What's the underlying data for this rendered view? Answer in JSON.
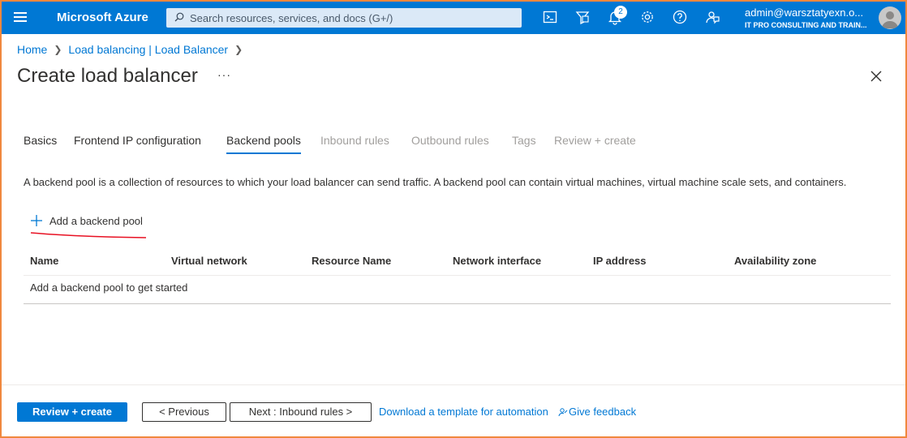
{
  "topbar": {
    "brand": "Microsoft Azure",
    "search_placeholder": "Search resources, services, and docs (G+/)",
    "notification_count": "2",
    "account_email": "admin@warsztatyexn.o...",
    "account_org": "IT PRO CONSULTING AND TRAIN...",
    "icons": [
      "menu-icon",
      "cloud-shell-icon",
      "directory-filter-icon",
      "bell-icon",
      "gear-icon",
      "help-icon",
      "feedback-icon"
    ],
    "accent": "#0078d4"
  },
  "breadcrumb": [
    "Home",
    "Load balancing | Load Balancer"
  ],
  "page": {
    "title": "Create load balancer",
    "more": "···"
  },
  "tabs": [
    {
      "label": "Basics",
      "state": "normal"
    },
    {
      "label": "Frontend IP configuration",
      "state": "normal"
    },
    {
      "label": "Backend pools",
      "state": "active"
    },
    {
      "label": "Inbound rules",
      "state": "disabled"
    },
    {
      "label": "Outbound rules",
      "state": "disabled"
    },
    {
      "label": "Tags",
      "state": "disabled"
    },
    {
      "label": "Review + create",
      "state": "disabled"
    }
  ],
  "description": "A backend pool is a collection of resources to which your load balancer can send traffic. A backend pool can contain virtual machines, virtual machine scale sets, and containers.",
  "add_pool_label": "Add a backend pool",
  "table": {
    "columns": [
      "Name",
      "Virtual network",
      "Resource Name",
      "Network interface",
      "IP address",
      "Availability zone"
    ],
    "empty_message": "Add a backend pool to get started"
  },
  "footer": {
    "review_create": "Review + create",
    "previous": "< Previous",
    "next": "Next : Inbound rules >",
    "download_template": "Download a template for automation",
    "give_feedback": "Give feedback"
  },
  "colors": {
    "primary": "#0078d4",
    "frame": "#f0883e",
    "annotation": "#e81123"
  }
}
